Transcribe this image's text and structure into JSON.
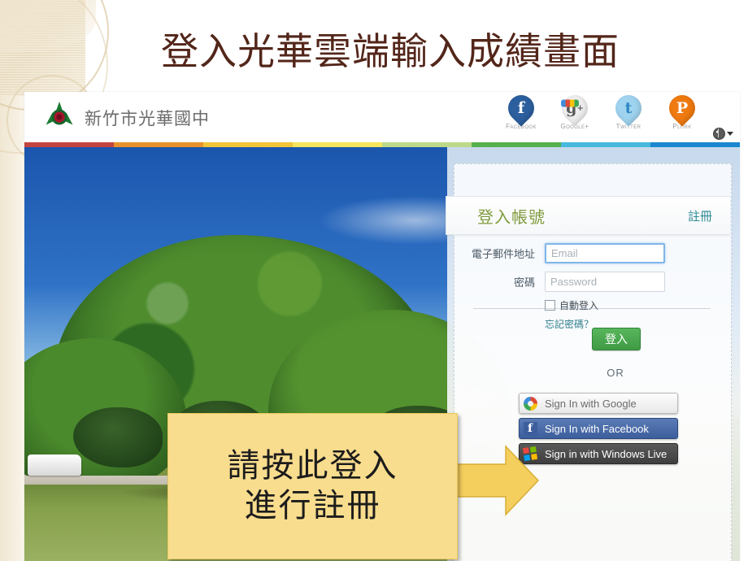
{
  "slide": {
    "title": "登入光華雲端輸入成績畫面"
  },
  "site_header": {
    "logo_icon": "school-emblem-icon",
    "school_name": "新竹市光華國中",
    "socials": [
      {
        "icon": "facebook-icon",
        "label": "Facebook",
        "glyph": "f",
        "color": "#2c5f9e"
      },
      {
        "icon": "google-plus-icon",
        "label": "Google+",
        "glyph": "g+",
        "color": "#eeeeee"
      },
      {
        "icon": "twitter-icon",
        "label": "Twitter",
        "glyph": "t",
        "color": "#9fd3ef"
      },
      {
        "icon": "plurk-icon",
        "label": "Plurk",
        "glyph": "P",
        "color": "#ef7a10"
      }
    ],
    "language_selector": {
      "icon": "globe-icon",
      "caret_icon": "chevron-down-icon"
    }
  },
  "rainbow_stripe": {
    "colors": [
      "#c2463f",
      "#e8922c",
      "#f2c438",
      "#f7e55c",
      "#bcd98a",
      "#56b04c",
      "#46b9dd",
      "#1a86d0"
    ]
  },
  "hero": {
    "alt_description": "校園大樹與藍天照片"
  },
  "login_panel": {
    "title": "登入帳號",
    "register_link": "註冊",
    "fields": [
      {
        "label": "電子郵件地址",
        "placeholder": "Email",
        "value": "",
        "type": "email",
        "focused": true
      },
      {
        "label": "密碼",
        "placeholder": "Password",
        "value": "",
        "type": "password",
        "focused": false
      }
    ],
    "auto_login": {
      "label": "自動登入",
      "checked": false
    },
    "forgot_password": "忘記密碼？",
    "login_button": "登入",
    "or_divider": "OR",
    "oauth_buttons": [
      {
        "label": "Sign In with Google",
        "icon": "google-logo-icon",
        "style": "google"
      },
      {
        "label": "Sign In with Facebook",
        "icon": "facebook-logo-icon",
        "style": "facebook"
      },
      {
        "label": "Sign in with Windows Live",
        "icon": "windows-logo-icon",
        "style": "windows"
      }
    ]
  },
  "annotation": {
    "line1": "請按此登入",
    "line2": "進行註冊",
    "arrow_icon": "right-arrow-icon",
    "box_color": "#f9dd8e",
    "arrow_color": "#f5cf5d"
  }
}
